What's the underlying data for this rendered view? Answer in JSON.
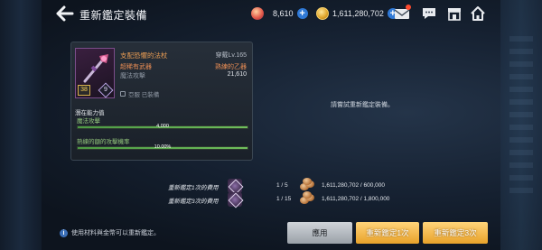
{
  "header": {
    "title": "重新鑑定裝備",
    "gems": "8,610",
    "gold": "1,611,280,702"
  },
  "icons": {
    "back": "back-arrow-icon",
    "gem": "gem-icon",
    "coin": "gold-coin-icon",
    "mail": "mail-icon",
    "chat": "chat-icon",
    "shop": "shop-icon",
    "home": "home-icon",
    "material": "reappraisal-material-icon"
  },
  "colors": {
    "accent_button": "#e8a22a",
    "option_bar": "#6fbe5c",
    "item_name": "#e79b53",
    "notification": "#ff4a2e"
  },
  "item": {
    "name": "支配恐懼的法杖",
    "equipped": "穿戴Lv.165",
    "type": "超稀有武器",
    "slot": "熟練的乙器",
    "stat_label": "魔法攻擊",
    "stat_value": "21,610",
    "lock": "亞服 已裝備",
    "level": "38",
    "grade": "9"
  },
  "options": {
    "title": "潛在能力值",
    "rows": [
      {
        "label": "魔法攻擊",
        "value": "4,000",
        "fill": 1.0
      },
      {
        "label": "熟練的額的攻擊機率",
        "value": "10.00%",
        "fill": 1.0
      }
    ]
  },
  "hint": "請嘗試重新鑑定裝備。",
  "costs": [
    {
      "label": "重新鑑定1次的費用",
      "materials": "1 / 5",
      "gold": "1,611,280,702 / 600,000"
    },
    {
      "label": "重新鑑定3次的費用",
      "materials": "1 / 15",
      "gold": "1,611,280,702 / 1,800,000"
    }
  ],
  "footer": {
    "info": "使用材料與金幣可以重新鑑定。",
    "apply": "應用",
    "reappraise_once": "重新鑑定1次",
    "reappraise_three": "重新鑑定3次"
  }
}
